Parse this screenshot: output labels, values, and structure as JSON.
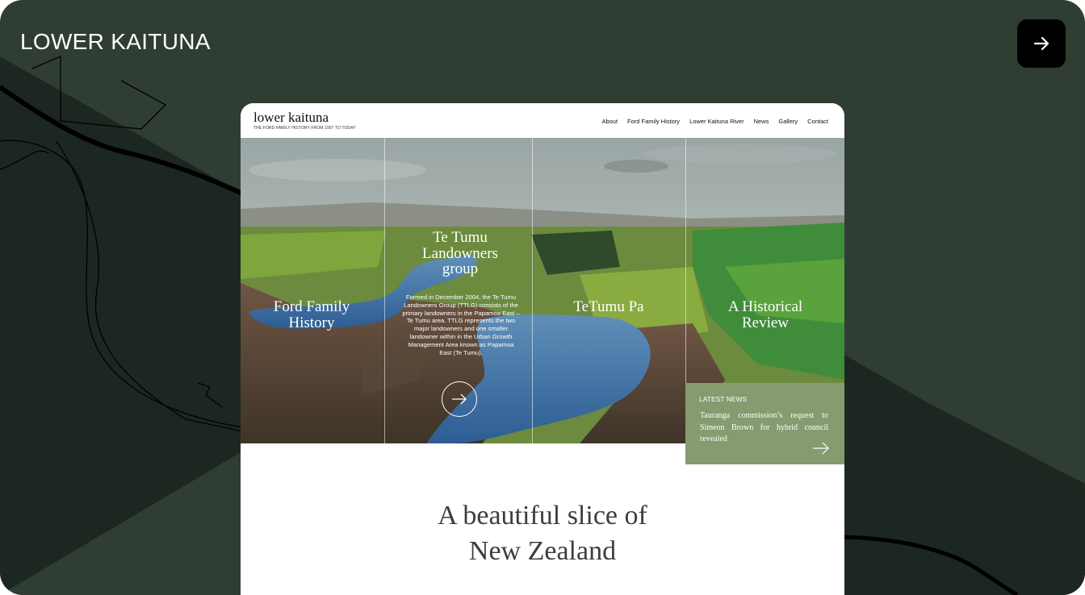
{
  "card": {
    "title": "LOWER KAITUNA",
    "open_icon": "arrow-right-icon"
  },
  "site": {
    "logo": {
      "name": "lower kaituna",
      "tagline": "THE FORD FAMILY HISTORY FROM 1907 TO TODAY"
    },
    "nav": [
      "About",
      "Ford Family History",
      "Lower Kaituna River",
      "News",
      "Gallery",
      "Contact"
    ],
    "panels": [
      {
        "title": "Ford Family History"
      },
      {
        "title": "Te Tumu Landowners group",
        "description": "Formed in December 2004, the Te Tumu Landowners Group (TTLG) consists of the primary landowners in the Papamoa East – Te Tumu area. TTLG represents the two major landowners and one smaller landowner within in the Urban Growth Management Area known as Papamoa East (Te Tumu).",
        "button_icon": "arrow-right-icon"
      },
      {
        "title": "TeTumu Pa"
      },
      {
        "title": "A Historical Review"
      }
    ],
    "news": {
      "label": "LATEST NEWS",
      "text": "Tauranga commission’s request to Simeon Brown for hybrid council revealed",
      "icon": "arrow-right-icon"
    },
    "intro_line1": "A beautiful slice of",
    "intro_line2": "New Zealand"
  },
  "colors": {
    "card_bg": "#2f3d33",
    "card_dark": "#1c2620",
    "news_bg": "#869b6f",
    "text_dark": "#3a3f3c"
  }
}
